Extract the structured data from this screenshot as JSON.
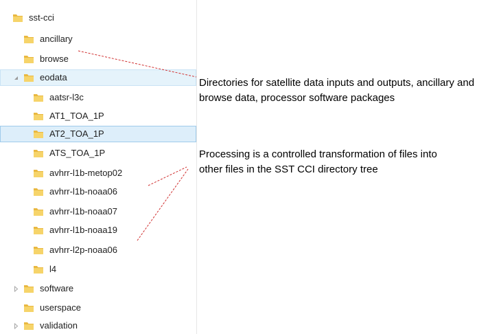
{
  "tree": {
    "items": [
      {
        "label": "sst-cci"
      },
      {
        "label": "ancillary"
      },
      {
        "label": "browse"
      },
      {
        "label": "eodata"
      },
      {
        "label": "aatsr-l3c"
      },
      {
        "label": "AT1_TOA_1P"
      },
      {
        "label": "AT2_TOA_1P"
      },
      {
        "label": "ATS_TOA_1P"
      },
      {
        "label": "avhrr-l1b-metop02"
      },
      {
        "label": "avhrr-l1b-noaa06"
      },
      {
        "label": "avhrr-l1b-noaa07"
      },
      {
        "label": "avhrr-l1b-noaa19"
      },
      {
        "label": "avhrr-l2p-noaa06"
      },
      {
        "label": "l4"
      },
      {
        "label": "software"
      },
      {
        "label": "userspace"
      },
      {
        "label": "validation"
      }
    ]
  },
  "annotations": {
    "directories": "Directories for satellite data inputs and outputs, ancillary and browse data, processor software packages",
    "processing": "Processing is a controlled transformation of files into other files in the SST CCI directory tree"
  },
  "colors": {
    "folder_body": "#e9b840",
    "folder_front": "#f6d46a",
    "highlight": "#e5f3fb",
    "selected": "#ddeefa",
    "leader_line": "#d03030"
  },
  "icons": {
    "folder": "folder-icon",
    "expanded": "chevron-down-icon",
    "collapsed": "chevron-right-icon"
  }
}
